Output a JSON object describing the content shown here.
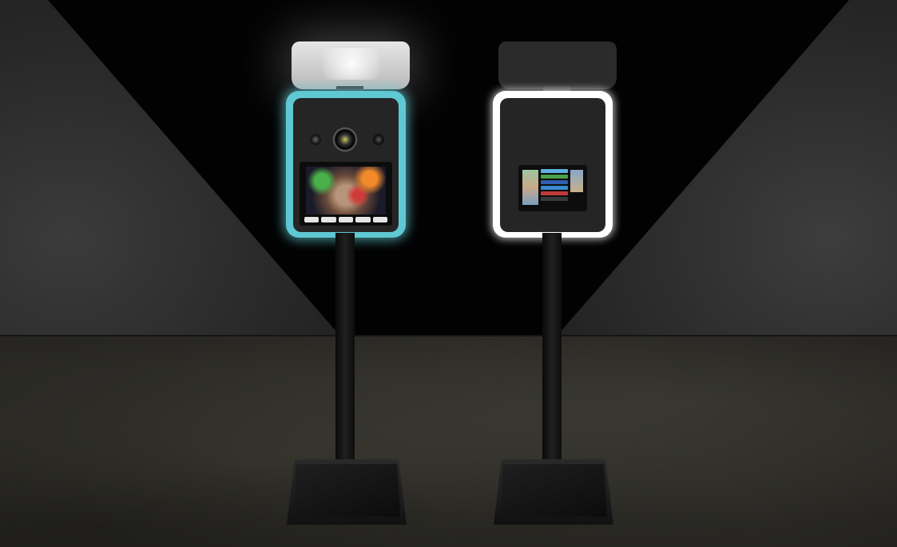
{
  "scene": {
    "colors": {
      "background": "#020202",
      "floor": "#2e2d28",
      "wall": "#2a2a2a",
      "booth_a_glow": "#5fc8d2",
      "booth_b_glow": "#ffffff",
      "booth_body": "#252525"
    },
    "booths": [
      {
        "id": "booth-a",
        "frame_glow": "cyan",
        "has_camera": true,
        "screen_buttons": 5
      },
      {
        "id": "booth-b",
        "frame_glow": "white",
        "has_camera": false,
        "menu_item_colors": [
          "#5fb0e0",
          "#4aa04a",
          "#2f5fb0",
          "#3a8ad0",
          "#c03a3a",
          "#3a3a3a"
        ]
      }
    ]
  }
}
